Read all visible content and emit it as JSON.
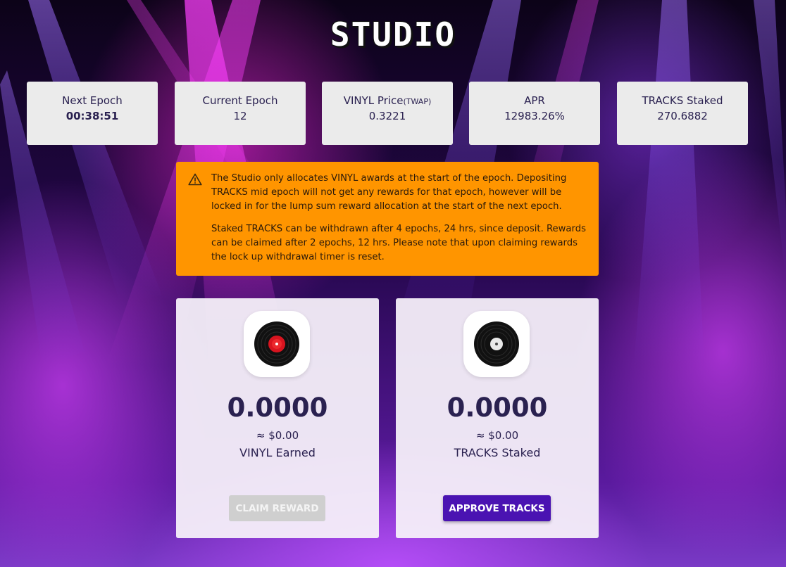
{
  "page": {
    "title": "STUDIO"
  },
  "stats": {
    "next_epoch": {
      "label": "Next Epoch",
      "value": "00:38:51"
    },
    "current_epoch": {
      "label": "Current Epoch",
      "value": "12"
    },
    "vinyl_price": {
      "label": "VINYL Price",
      "label_suffix": "(TWAP)",
      "value": "0.3221"
    },
    "apr": {
      "label": "APR",
      "value": "12983.26%"
    },
    "tracks_staked": {
      "label": "TRACKS Staked",
      "value": "270.6882"
    }
  },
  "warning": {
    "icon": "warning-triangle-icon",
    "paragraph_1": "The Studio only allocates VINYL awards at the start of the epoch. Depositing TRACKS mid epoch will not get any rewards for that epoch, however will be locked in for the lump sum reward allocation at the start of the next epoch.",
    "paragraph_2": "Staked TRACKS can be withdrawn after 4 epochs, 24 hrs, since deposit. Rewards can be claimed after 2 epochs, 12 hrs. Please note that upon claiming rewards the lock up withdrawal timer is reset."
  },
  "cards": {
    "earned": {
      "icon": "vinyl-record-red-icon",
      "amount": "0.0000",
      "usd": "≈ $0.00",
      "label": "VINYL Earned",
      "button": "CLAIM REWARD"
    },
    "staked": {
      "icon": "vinyl-record-white-icon",
      "amount": "0.0000",
      "usd": "≈ $0.00",
      "label": "TRACKS Staked",
      "button": "APPROVE TRACKS"
    }
  },
  "colors": {
    "warning_bg": "#ff9500",
    "primary_button": "#4a13b2",
    "text_dark": "#2a2150"
  }
}
